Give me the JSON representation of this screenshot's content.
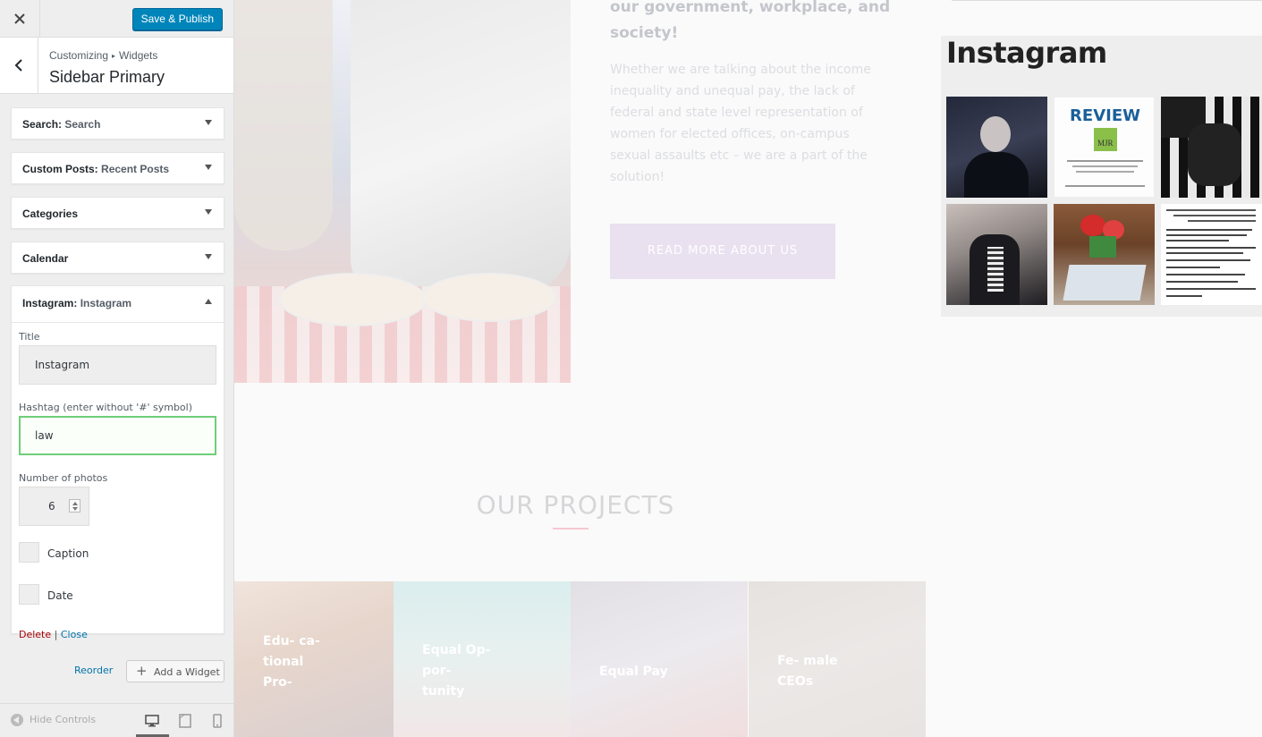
{
  "topbar": {
    "close_icon": "close-icon",
    "publish_label": "Save & Publish"
  },
  "section": {
    "crumb_parent": "Customizing",
    "crumb_child": "Widgets",
    "title": "Sidebar Primary"
  },
  "widgets": [
    {
      "type": "Search:",
      "name": "Search"
    },
    {
      "type": "Custom Posts:",
      "name": "Recent Posts"
    },
    {
      "type": "Categories",
      "name": ""
    },
    {
      "type": "Calendar",
      "name": ""
    },
    {
      "type": "Instagram:",
      "name": "Instagram"
    }
  ],
  "instagram_form": {
    "title_label": "Title",
    "title_value": "Instagram",
    "hashtag_label": "Hashtag (enter without '#' symbol)",
    "hashtag_value": "law",
    "photos_label": "Number of photos",
    "photos_value": "6",
    "caption_label": "Caption",
    "date_label": "Date",
    "delete_label": "Delete",
    "separator": "|",
    "close_label": "Close"
  },
  "actions": {
    "reorder_label": "Reorder",
    "add_widget_label": "Add a Widget"
  },
  "footer": {
    "hide_controls_label": "Hide Controls"
  },
  "preview": {
    "hero_heading": "our government, workplace, and society!",
    "hero_text": "Whether we are talking about the income inequality and unequal pay, the lack of federal and state level representation of women for elected offices, on-campus sexual assaults etc – we are a part of the solution!",
    "hero_button": "READ MORE ABOUT US",
    "projects_title": "OUR PROJECTS",
    "projects": [
      {
        "label": "Edu- ca- tional Pro-"
      },
      {
        "label": "Equal Op- por- tunity"
      },
      {
        "label": "Equal Pay"
      },
      {
        "label": "Fe- male CEOs"
      }
    ],
    "instagram_title": "Instagram",
    "review_text": "REVIEW",
    "mjr_text": "MJR"
  },
  "colors": {
    "primary_button": "#0085ba",
    "focus_border": "#6fce78",
    "delete_link": "#aa0000",
    "link": "#0073aa",
    "cta_button": "#e9e0f0"
  }
}
